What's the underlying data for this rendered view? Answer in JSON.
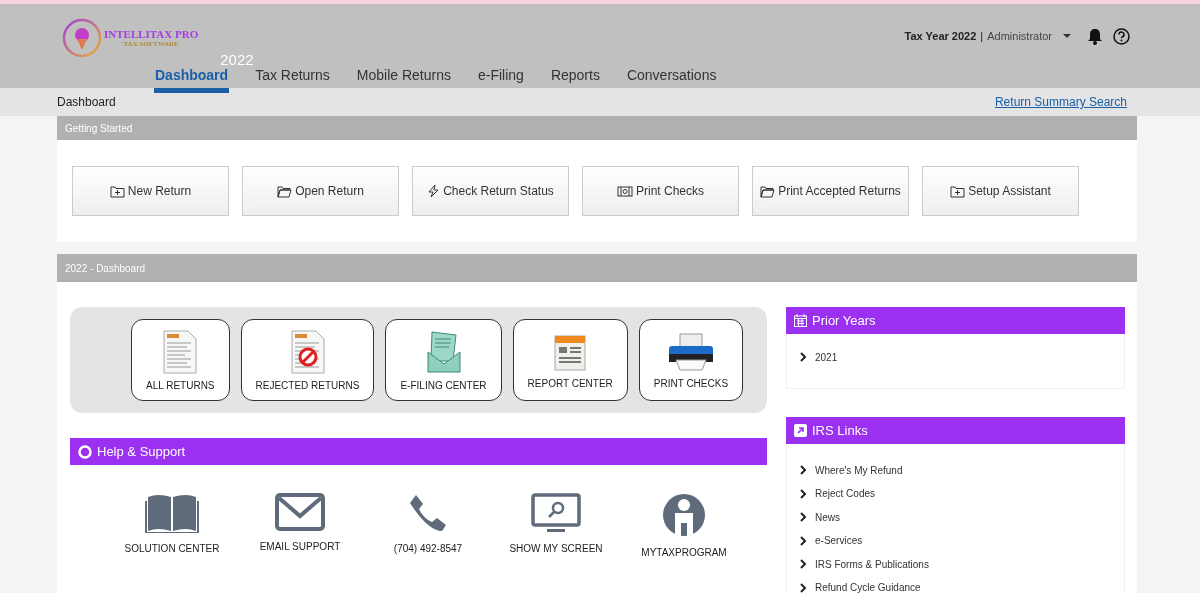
{
  "header": {
    "logo": {
      "name": "INTELLITAX PRO",
      "tagline": "TAX SOFTWARE"
    },
    "year": "2022",
    "tabs": [
      {
        "label": "Dashboard",
        "selected": true
      },
      {
        "label": "Tax Returns",
        "selected": false
      },
      {
        "label": "Mobile Returns",
        "selected": false
      },
      {
        "label": "e-Filing",
        "selected": false
      },
      {
        "label": "Reports",
        "selected": false
      },
      {
        "label": "Conversations",
        "selected": false
      }
    ],
    "tax_year": "Tax Year 2022",
    "separator": "|",
    "user": "Administrator"
  },
  "breadcrumb": "Dashboard",
  "return_summary_link": "Return Summary Search",
  "getting_started": {
    "title": "Getting Started",
    "buttons": [
      {
        "label": "New Return",
        "kind": "folder-plus"
      },
      {
        "label": "Open Return",
        "kind": "folder"
      },
      {
        "label": "Check Return Status",
        "kind": "bolt"
      },
      {
        "label": "Print Checks",
        "kind": "money"
      },
      {
        "label": "Print Accepted Returns",
        "kind": "folder"
      },
      {
        "label": "Setup Assistant",
        "kind": "folder-plus"
      }
    ]
  },
  "dashboard": {
    "title": "2022 - Dashboard",
    "tiles": [
      {
        "label": "ALL RETURNS",
        "kind": "form"
      },
      {
        "label": "REJECTED RETURNS",
        "kind": "rejected-form"
      },
      {
        "label": "E-FILING CENTER",
        "kind": "envelope"
      },
      {
        "label": "REPORT CENTER",
        "kind": "report"
      },
      {
        "label": "PRINT CHECKS",
        "kind": "printer"
      }
    ],
    "help": {
      "title": "Help & Support",
      "items": [
        {
          "label": "SOLUTION CENTER",
          "kind": "book"
        },
        {
          "label": "EMAIL SUPPORT",
          "kind": "mail"
        },
        {
          "label": "(704) 492-8547",
          "kind": "phone"
        },
        {
          "label": "SHOW MY SCREEN",
          "kind": "screen"
        },
        {
          "label": "MYTAXPROGRAM",
          "kind": "person"
        }
      ]
    },
    "prior_years": {
      "title": "Prior Years",
      "items": [
        "2021"
      ]
    },
    "irs_links": {
      "title": "IRS Links",
      "items": [
        "Where's My Refund",
        "Reject Codes",
        "News",
        "e-Services",
        "IRS Forms & Publications",
        "Refund Cycle Guidance"
      ]
    }
  }
}
